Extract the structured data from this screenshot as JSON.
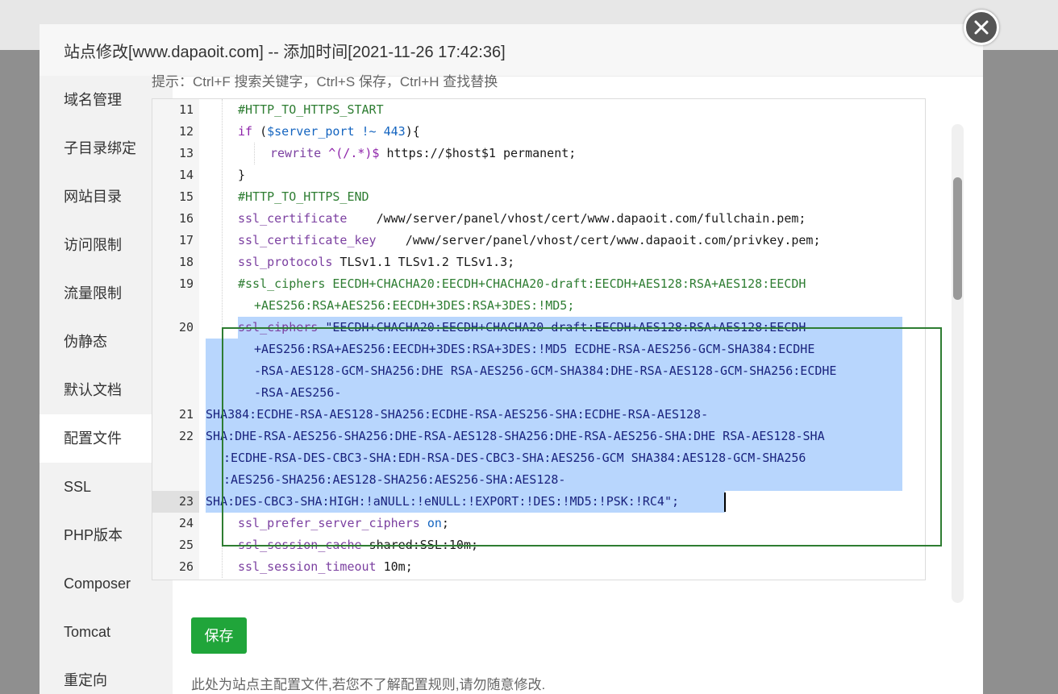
{
  "dialog": {
    "title": "站点修改[www.dapaoit.com] -- 添加时间[2021-11-26 17:42:36]"
  },
  "icons": {
    "close": "close-icon"
  },
  "colors": {
    "accent": "#20a53a",
    "selection": "#b8d6fd",
    "highlight_box": "#2e7d32"
  },
  "sidebar": {
    "items": [
      {
        "label": "域名管理"
      },
      {
        "label": "子目录绑定"
      },
      {
        "label": "网站目录"
      },
      {
        "label": "访问限制"
      },
      {
        "label": "流量限制"
      },
      {
        "label": "伪静态"
      },
      {
        "label": "默认文档"
      },
      {
        "label": "配置文件"
      },
      {
        "label": "SSL"
      },
      {
        "label": "PHP版本"
      },
      {
        "label": "Composer"
      },
      {
        "label": "Tomcat"
      },
      {
        "label": "重定向"
      }
    ],
    "active_index": 7
  },
  "editor": {
    "hint": "提示：Ctrl+F 搜索关键字，Ctrl+S 保存，Ctrl+H 查找替换",
    "line_numbers": [
      "11",
      "12",
      "13",
      "14",
      "15",
      "16",
      "17",
      "18",
      "19",
      "20",
      "21",
      "22",
      "23",
      "24",
      "25",
      "26"
    ],
    "lines": [
      {
        "parts": [
          {
            "t": "#HTTP_TO_HTTPS_START",
            "c": "comment"
          }
        ]
      },
      {
        "parts": [
          {
            "t": "if ",
            "c": "kw"
          },
          {
            "t": "(",
            "c": ""
          },
          {
            "t": "$server_port",
            "c": "var"
          },
          {
            "t": " !~ ",
            "c": "op"
          },
          {
            "t": "443",
            "c": "num"
          },
          {
            "t": "){",
            "c": ""
          }
        ]
      },
      {
        "parts": [
          {
            "t": "rewrite ",
            "c": "key"
          },
          {
            "t": "^(/.*)$",
            "c": "kw"
          },
          {
            "t": " https://$host$1 permanent;",
            "c": ""
          }
        ]
      },
      {
        "parts": [
          {
            "t": "}",
            "c": ""
          }
        ]
      },
      {
        "parts": [
          {
            "t": "#HTTP_TO_HTTPS_END",
            "c": "comment"
          }
        ]
      },
      {
        "parts": [
          {
            "t": "ssl_certificate",
            "c": "key"
          },
          {
            "t": "    /www/server/panel/vhost/cert/www.dapaoit.com/fullchain.pem;",
            "c": ""
          }
        ]
      },
      {
        "parts": [
          {
            "t": "ssl_certificate_key",
            "c": "key"
          },
          {
            "t": "    /www/server/panel/vhost/cert/www.dapaoit.com/privkey.pem;",
            "c": ""
          }
        ]
      },
      {
        "parts": [
          {
            "t": "ssl_protocols",
            "c": "key"
          },
          {
            "t": " TLSv1.1 TLSv1.2 TLSv1.3;",
            "c": ""
          }
        ]
      },
      {
        "parts": [
          {
            "t": "#ssl_ciphers EECDH+CHACHA20:EECDH+CHACHA20-draft:EECDH+AES128:RSA+AES128:EECDH",
            "c": "comment"
          }
        ]
      },
      {
        "parts": [
          {
            "t": "+AES256:RSA+AES256:EECDH+3DES:RSA+3DES:!MD5;",
            "c": "comment"
          }
        ]
      },
      {
        "parts": [
          {
            "t": "ssl_ciphers",
            "c": "key"
          },
          {
            "t": " \"EECDH+CHACHA20:EECDH+CHACHA20-draft:EECDH+AES128:RSA+AES128:EECDH",
            "c": "str"
          }
        ]
      },
      {
        "parts": [
          {
            "t": "+AES256:RSA+AES256:EECDH+3DES:RSA+3DES:!MD5 ECDHE-RSA-AES256-GCM-SHA384:ECDHE",
            "c": "str"
          }
        ]
      },
      {
        "parts": [
          {
            "t": "-RSA-AES128-GCM-SHA256:DHE RSA-AES256-GCM-SHA384:DHE-RSA-AES128-GCM-SHA256:ECDHE",
            "c": "str"
          }
        ]
      },
      {
        "parts": [
          {
            "t": "-RSA-AES256-",
            "c": "str"
          }
        ]
      },
      {
        "parts": [
          {
            "t": "SHA384:ECDHE-RSA-AES128-SHA256:ECDHE-RSA-AES256-SHA:ECDHE-RSA-AES128-",
            "c": "str"
          }
        ]
      },
      {
        "parts": [
          {
            "t": "SHA:DHE-RSA-AES256-SHA256:DHE-RSA-AES128-SHA256:DHE-RSA-AES256-SHA:DHE RSA-AES128-SHA",
            "c": "str"
          }
        ]
      },
      {
        "parts": [
          {
            "t": ":ECDHE-RSA-DES-CBC3-SHA:EDH-RSA-DES-CBC3-SHA:AES256-GCM SHA384:AES128-GCM-SHA256",
            "c": "str"
          }
        ]
      },
      {
        "parts": [
          {
            "t": ":AES256-SHA256:AES128-SHA256:AES256-SHA:AES128-",
            "c": "str"
          }
        ]
      },
      {
        "parts": [
          {
            "t": "SHA:DES-CBC3-SHA:HIGH:!aNULL:!eNULL:!EXPORT:!DES:!MD5:!PSK:!RC4\";",
            "c": "str"
          }
        ]
      },
      {
        "parts": [
          {
            "t": "ssl_prefer_server_ciphers",
            "c": "key"
          },
          {
            "t": " ",
            "c": ""
          },
          {
            "t": "on",
            "c": "var"
          },
          {
            "t": ";",
            "c": ""
          }
        ]
      },
      {
        "parts": [
          {
            "t": "ssl_session_cache",
            "c": "key"
          },
          {
            "t": " shared:SSL:10m;",
            "c": ""
          }
        ]
      },
      {
        "parts": [
          {
            "t": "ssl_session_timeout",
            "c": "key"
          },
          {
            "t": " 10m;",
            "c": ""
          }
        ]
      }
    ]
  },
  "save_button": {
    "label": "保存"
  },
  "footnote": "此处为站点主配置文件,若您不了解配置规则,请勿随意修改."
}
